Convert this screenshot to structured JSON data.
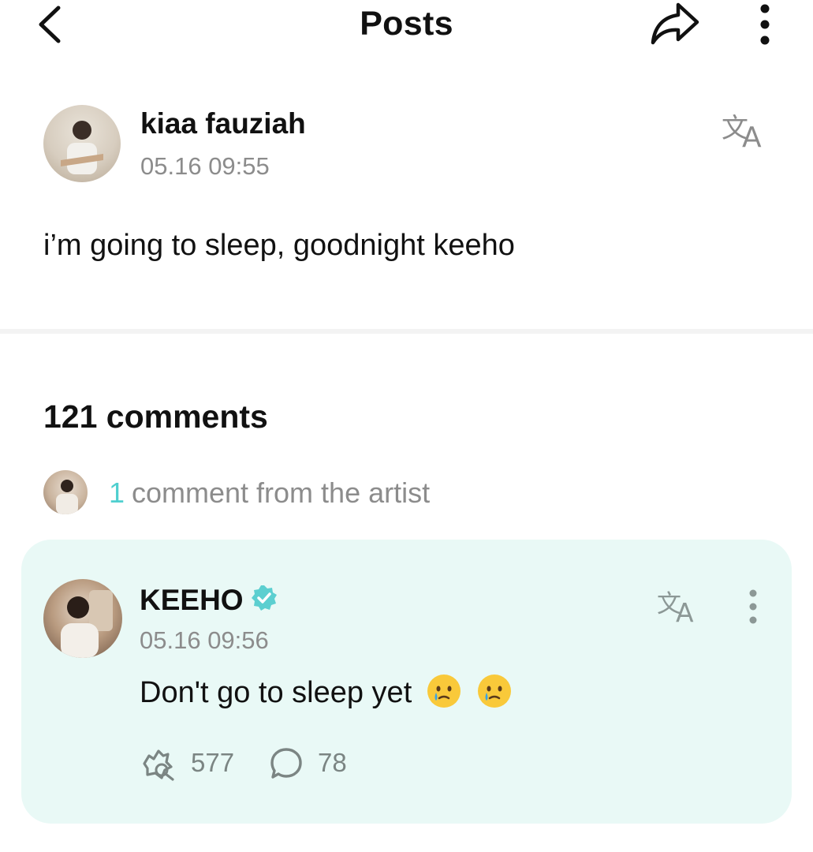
{
  "header": {
    "title": "Posts",
    "back_icon": "chevron-left-icon",
    "share_icon": "share-icon",
    "more_icon": "more-vertical-icon"
  },
  "post": {
    "author": "kiaa fauziah",
    "time": "05.16 09:55",
    "text": "i’m going to sleep, goodnight keeho",
    "translate_icon": "translate-icon"
  },
  "comments": {
    "count_label": "121 comments",
    "artist_comment_count": "1",
    "artist_comment_label": "comment from the artist",
    "artist_comment": {
      "author": "KEEHO",
      "verified": true,
      "time": "05.16 09:56",
      "text": "Don't go to sleep yet",
      "emojis": [
        "crying-face-emoji",
        "crying-face-emoji"
      ],
      "likes": "577",
      "replies": "78"
    }
  },
  "colors": {
    "accent": "#4fcfcf",
    "card_background": "#e9f9f6",
    "muted_text": "#8c8c8c",
    "verified_badge": "#5ccfd0"
  }
}
